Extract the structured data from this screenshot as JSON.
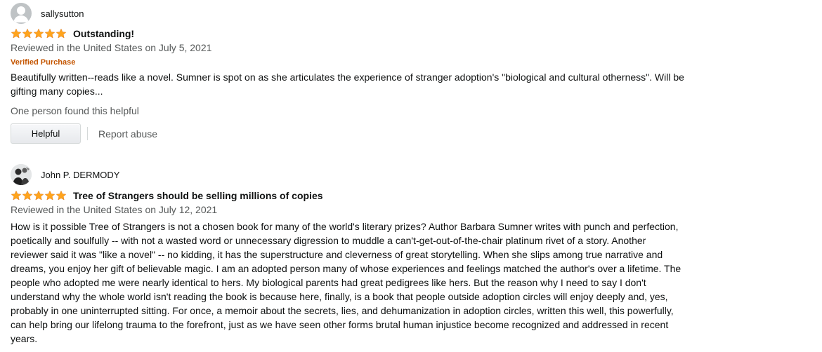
{
  "reviews": [
    {
      "reviewer": "sallysutton",
      "avatar_icon": "default-user-avatar-icon",
      "rating": 5,
      "title": "Outstanding!",
      "date_line": "Reviewed in the United States on July 5, 2021",
      "verified": "Verified Purchase",
      "body": "Beautifully written--reads like a novel. Sumner is spot on as she articulates the experience of stranger adoption's \"biological and cultural otherness\". Will be gifting many copies...",
      "helpful_count": "One person found this helpful",
      "helpful_button": "Helpful",
      "report_link": "Report abuse"
    },
    {
      "reviewer": "John P. DERMODY",
      "avatar_icon": "profile-photo-icon",
      "rating": 5,
      "title": "Tree of Strangers should be selling millions of copies",
      "date_line": "Reviewed in the United States on July 12, 2021",
      "body": "How is it possible Tree of Strangers is not a chosen book for many of the world's literary prizes? Author Barbara Sumner writes with punch and perfection, poetically and soulfully -- with not a wasted word or unnecessary digression to muddle a can't-get-out-of-the-chair platinum rivet of a story. Another reviewer said it was \"like a novel\" -- no kidding, it has the superstructure and cleverness of great storytelling. When she slips among true narrative and dreams, you enjoy her gift of believable magic. I am an adopted person many of whose experiences and feelings matched the author's over a lifetime. The people who adopted me were nearly identical to hers. My biological parents had great pedigrees like hers. But the reason why I need to say I don't understand why the whole world isn't reading the book is because here, finally, is a book that people outside adoption circles will enjoy deeply and, yes, probably in one uninterrupted sitting. For once, a memoir about the secrets, lies, and dehumanization in adoption circles, written this well, this powerfully, can help bring our lifelong trauma to the forefront, just as we have seen other forms brutal human injustice become recognized and addressed in recent years."
    }
  ],
  "colors": {
    "star": "#ffa41c",
    "verified": "#c45500",
    "muted_text": "#565959",
    "text": "#0f1111"
  }
}
